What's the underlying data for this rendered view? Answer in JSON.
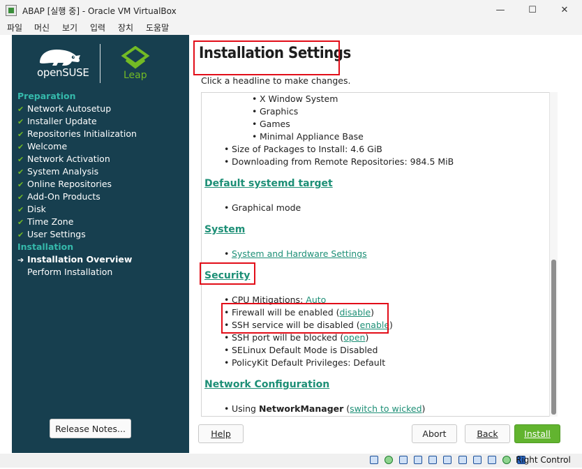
{
  "window": {
    "title": "ABAP [실행 중] - Oracle VM VirtualBox",
    "minimize_glyph": "—",
    "maximize_glyph": "☐",
    "close_glyph": "✕"
  },
  "menubar": {
    "items": [
      "파일",
      "머신",
      "보기",
      "입력",
      "장치",
      "도움말"
    ]
  },
  "colors": {
    "sidebar_bg": "#173f4f",
    "accent_teal": "#35b9ab",
    "accent_green": "#73ba25",
    "link": "#1d8f76",
    "highlight_box": "#e20d18",
    "install_button": "#62b42f"
  },
  "sidebar": {
    "logo_left": "openSUSE",
    "logo_right": "Leap",
    "check_glyph": "✔",
    "arrow_glyph": "➔",
    "sections": [
      {
        "title": "Preparation",
        "items": [
          {
            "label": "Network Autosetup",
            "status": "done"
          },
          {
            "label": "Installer Update",
            "status": "done"
          },
          {
            "label": "Repositories Initialization",
            "status": "done"
          },
          {
            "label": "Welcome",
            "status": "done"
          },
          {
            "label": "Network Activation",
            "status": "done"
          },
          {
            "label": "System Analysis",
            "status": "done"
          },
          {
            "label": "Online Repositories",
            "status": "done"
          },
          {
            "label": "Add-On Products",
            "status": "done"
          },
          {
            "label": "Disk",
            "status": "done"
          },
          {
            "label": "Time Zone",
            "status": "done"
          },
          {
            "label": "User Settings",
            "status": "done"
          }
        ]
      },
      {
        "title": "Installation",
        "items": [
          {
            "label": "Installation Overview",
            "status": "current"
          },
          {
            "label": "Perform Installation",
            "status": "pending"
          }
        ]
      }
    ],
    "release_notes_label": "Release Notes..."
  },
  "main": {
    "title": "Installation Settings",
    "subtitle": "Click a headline to make changes.",
    "software": {
      "patterns": [
        "X Window System",
        "Graphics",
        "Games",
        "Minimal Appliance Base"
      ],
      "package_size": "Size of Packages to Install: 4.6 GiB",
      "download": "Downloading from Remote Repositories: 984.5 MiB"
    },
    "systemd": {
      "heading": "Default systemd target",
      "value": "Graphical mode"
    },
    "system": {
      "heading": "System",
      "link": "System and Hardware Settings"
    },
    "security": {
      "heading": "Security",
      "cpu_label": "CPU Mitigations: ",
      "cpu_value": "Auto",
      "firewall_text": "Firewall will be enabled (",
      "firewall_link": "disable",
      "ssh_text": "SSH service will be disabled (",
      "ssh_link": "enable",
      "ssh_port_text": "SSH port will be blocked (",
      "ssh_port_link": "open",
      "selinux": "SELinux Default Mode is Disabled",
      "polkit": "PolicyKit Default Privileges: Default",
      "close_paren": ")"
    },
    "network": {
      "heading": "Network Configuration",
      "prefix": "Using ",
      "manager": "NetworkManager",
      "open_paren": " (",
      "link": "switch to wicked",
      "close_paren": ")"
    },
    "buttons": {
      "help": "Help",
      "abort": "Abort",
      "back": "Back",
      "install": "Install"
    }
  },
  "statusbar": {
    "host_key": "Right Control"
  }
}
